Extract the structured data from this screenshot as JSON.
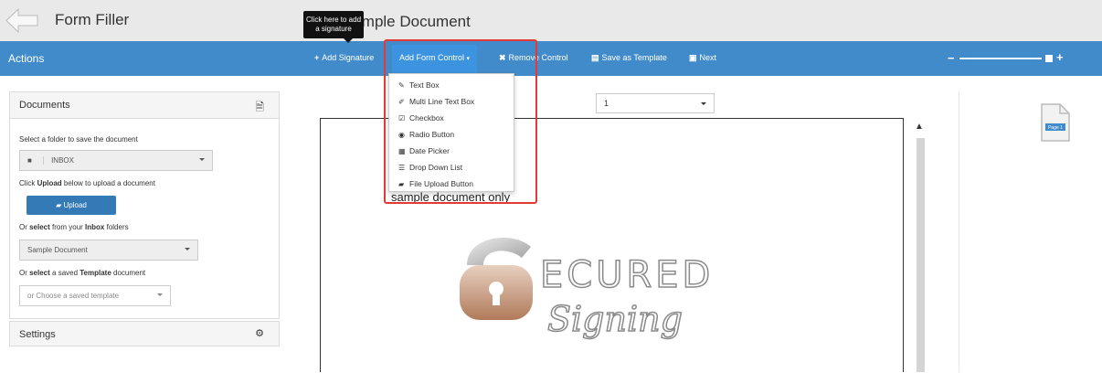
{
  "header": {
    "app_title": "Form Filler",
    "doc_title": "Sample Document",
    "tooltip": "Click here to add a signature"
  },
  "toolbar": {
    "actions_label": "Actions",
    "add_signature": "Add Signature",
    "add_form_control": "Add Form Control",
    "remove_control": "Remove Control",
    "save_template": "Save as Template",
    "next": "Next"
  },
  "form_controls_menu": [
    {
      "icon": "pencil-icon",
      "label": "Text Box"
    },
    {
      "icon": "edit-icon",
      "label": "Multi Line Text Box"
    },
    {
      "icon": "checkbox-icon",
      "label": "Checkbox"
    },
    {
      "icon": "radio-icon",
      "label": "Radio Button"
    },
    {
      "icon": "calendar-icon",
      "label": "Date Picker"
    },
    {
      "icon": "list-icon",
      "label": "Drop Down List"
    },
    {
      "icon": "folder-open-icon",
      "label": "File Upload Button"
    }
  ],
  "sidebar": {
    "documents_title": "Documents",
    "select_folder_label": "Select a folder to save the document",
    "folder_value": "INBOX",
    "upload_hint_pre": "Click ",
    "upload_hint_bold": "Upload",
    "upload_hint_post": " below to upload a document",
    "upload_button": "Upload",
    "inbox_hint_pre": "Or ",
    "inbox_hint_bold1": "select",
    "inbox_hint_mid": " from your ",
    "inbox_hint_bold2": "Inbox",
    "inbox_hint_post": " folders",
    "inbox_value": "Sample Document",
    "template_hint_pre": "Or ",
    "template_hint_bold1": "select",
    "template_hint_mid": " a saved ",
    "template_hint_bold2": "Template",
    "template_hint_post": " document",
    "template_placeholder": "or Choose a saved template",
    "settings_title": "Settings"
  },
  "viewer": {
    "page_select_value": "1",
    "sample_text": "sample document only",
    "thumbnail_label": "Page 1",
    "logo_word1": "ECURED",
    "logo_word2": "Signing"
  },
  "colors": {
    "action_bar": "#428bca",
    "highlight": "#e53935"
  }
}
